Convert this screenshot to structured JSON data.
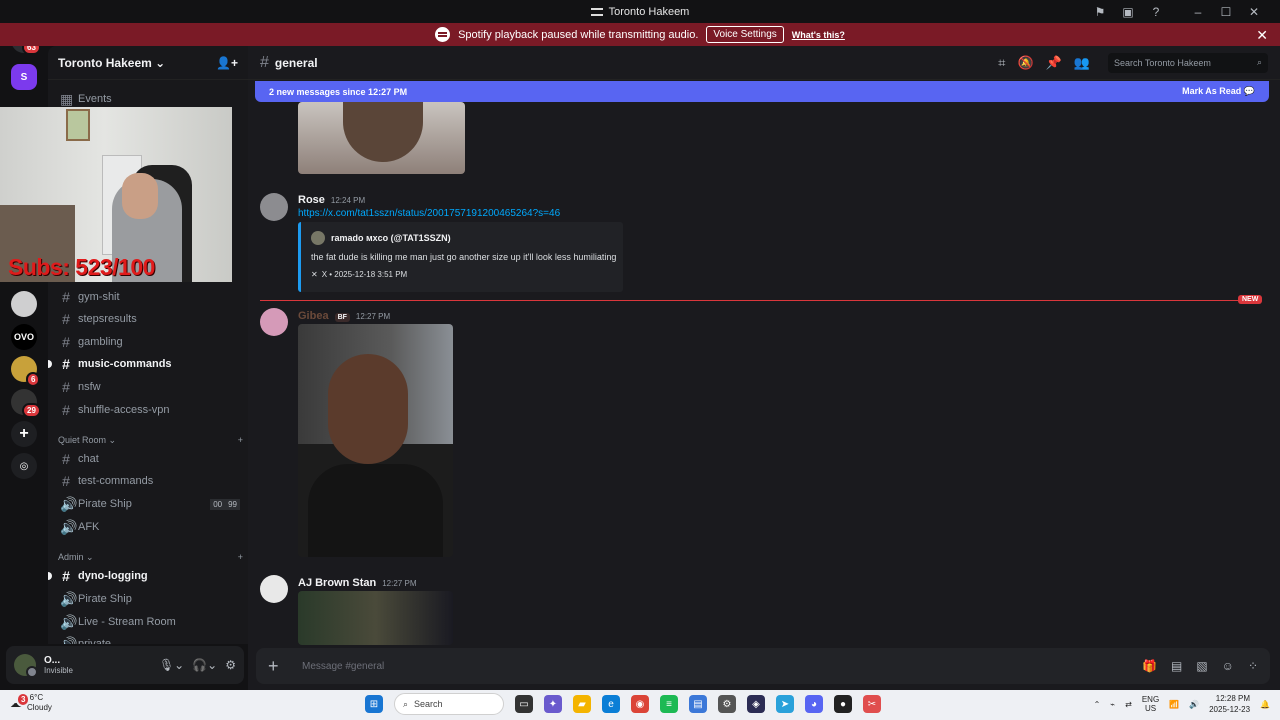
{
  "window": {
    "title": "Toronto Hakeem"
  },
  "banner": {
    "message": "Spotify playback paused while transmitting audio.",
    "button": "Voice Settings",
    "link": "What's this?"
  },
  "rail": {
    "home_badge": "63",
    "badges": [
      "6",
      "29"
    ],
    "ovo_label": "OVO"
  },
  "server": {
    "name": "Toronto Hakeem",
    "events_label": "Events"
  },
  "overlay": {
    "subs_text": "Subs: 523/100"
  },
  "channels": {
    "top": [
      {
        "name": "gym-shit",
        "bright": false
      },
      {
        "name": "stepsresults",
        "bright": false
      },
      {
        "name": "gambling",
        "bright": false
      },
      {
        "name": "music-commands",
        "bright": true
      },
      {
        "name": "nsfw",
        "bright": false
      },
      {
        "name": "shuffle-access-vpn",
        "bright": false
      }
    ],
    "quiet_room_label": "Quiet Room",
    "quiet": [
      "chat",
      "test-commands"
    ],
    "voice1": "Pirate Ship",
    "voice1_counts": [
      "00",
      "99"
    ],
    "afk": "AFK",
    "admin_label": "Admin",
    "admin_text": [
      "dyno-logging"
    ],
    "admin_voice": [
      "Pirate Ship",
      "Live - Stream Room",
      "private"
    ]
  },
  "user": {
    "name": "O...",
    "status": "Invisible"
  },
  "chat": {
    "channel": "general",
    "search_placeholder": "Search Toronto Hakeem",
    "new_messages": "2 new messages since 12:27 PM",
    "mark_read": "Mark As Read",
    "new_tag": "NEW",
    "composer_placeholder": "Message #general",
    "messages": [
      {
        "author": "Rose",
        "time": "12:24 PM",
        "link": "https://x.com/tat1sszn/status/2001757191200465264?s=46",
        "embed": {
          "author": "ramado ᴍхᴄᴏ (@TAT1SSZN)",
          "text": "the fat dude is killing me man just go another size up it'll look less humiliating",
          "footer": "X • 2025-12-18 3:51 PM"
        }
      },
      {
        "author": "Gibea",
        "role": "BF",
        "time": "12:27 PM"
      },
      {
        "author": "AJ Brown Stan",
        "time": "12:27 PM"
      }
    ]
  },
  "taskbar": {
    "weather_temp": "-6°C",
    "weather_desc": "Cloudy",
    "weather_badge": "3",
    "search": "Search",
    "lang1": "ENG",
    "lang2": "US",
    "time": "12:28 PM",
    "date": "2025-12-23"
  },
  "colors": {
    "accent": "#5865f2",
    "banner": "#7a1a26",
    "link": "#00a8fc",
    "new": "#da373c"
  }
}
